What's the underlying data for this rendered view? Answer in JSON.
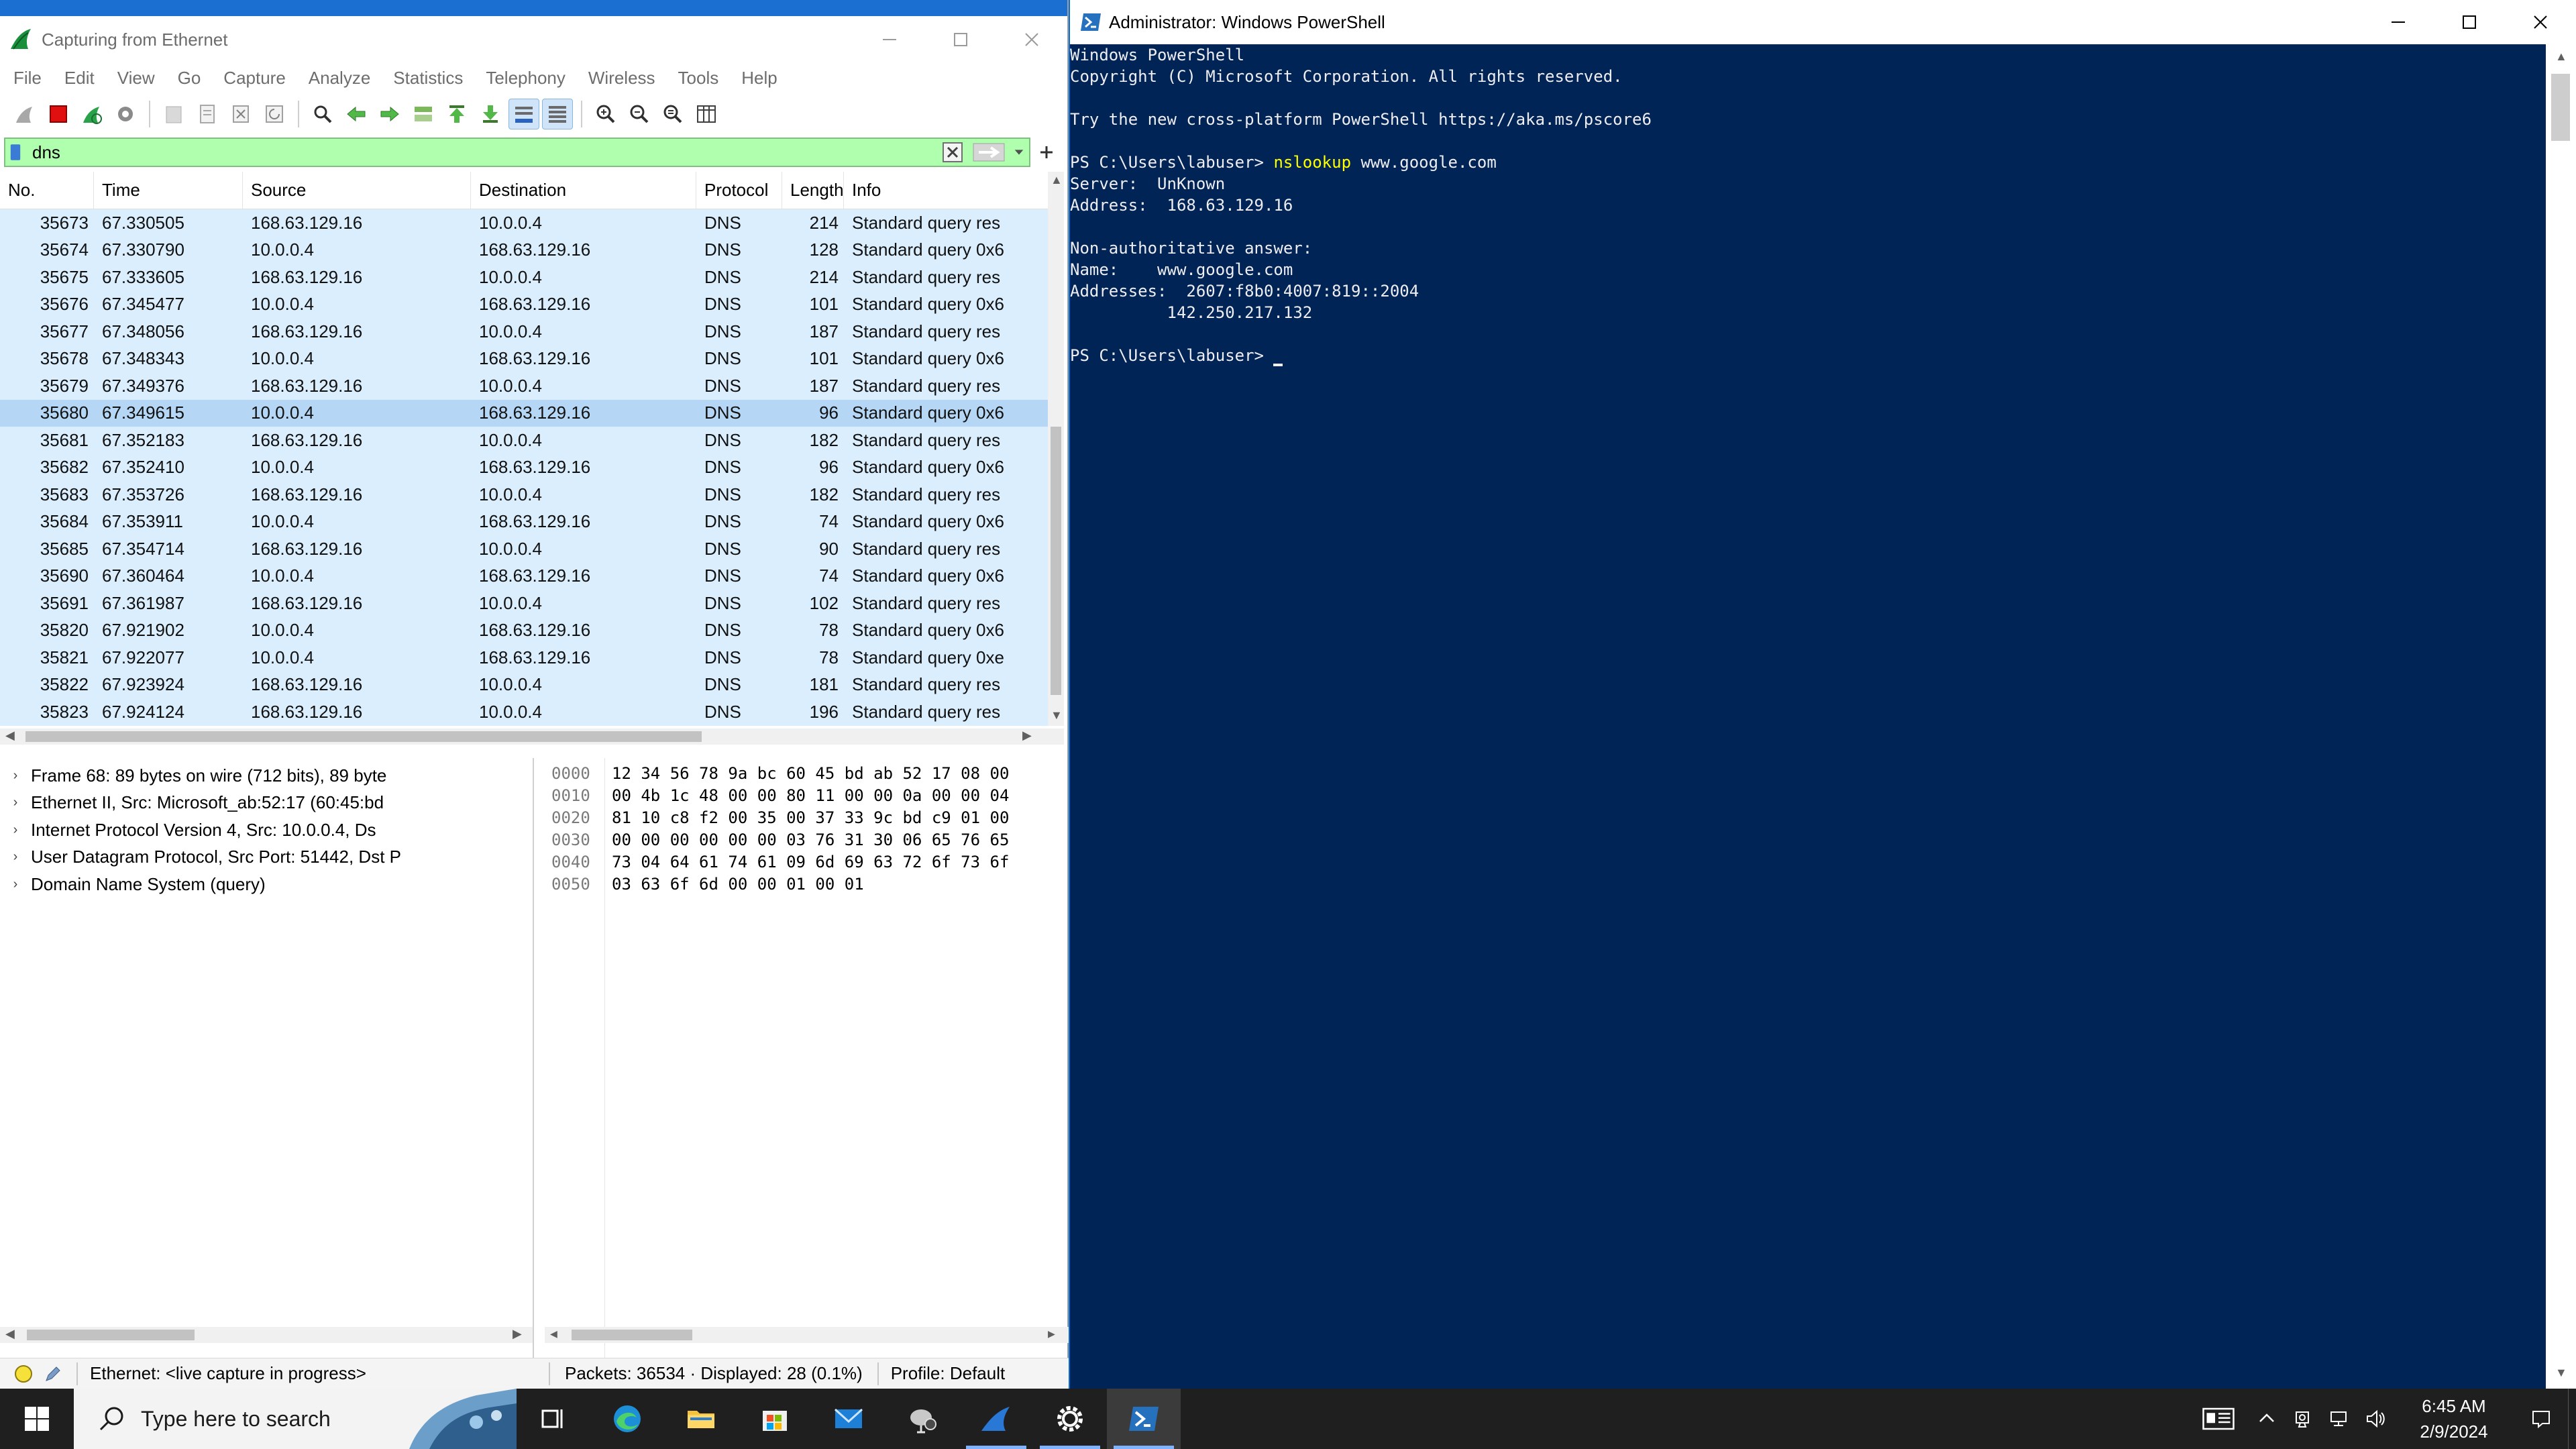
{
  "wireshark": {
    "title": "Capturing from Ethernet",
    "menu": [
      "File",
      "Edit",
      "View",
      "Go",
      "Capture",
      "Analyze",
      "Statistics",
      "Telephony",
      "Wireless",
      "Tools",
      "Help"
    ],
    "filter_value": "dns",
    "columns": [
      "No.",
      "Time",
      "Source",
      "Destination",
      "Protocol",
      "Length",
      "Info"
    ],
    "packets": [
      {
        "no": "35673",
        "time": "67.330505",
        "src": "168.63.129.16",
        "dst": "10.0.0.4",
        "proto": "DNS",
        "len": "214",
        "info": "Standard query res"
      },
      {
        "no": "35674",
        "time": "67.330790",
        "src": "10.0.0.4",
        "dst": "168.63.129.16",
        "proto": "DNS",
        "len": "128",
        "info": "Standard query 0x6"
      },
      {
        "no": "35675",
        "time": "67.333605",
        "src": "168.63.129.16",
        "dst": "10.0.0.4",
        "proto": "DNS",
        "len": "214",
        "info": "Standard query res"
      },
      {
        "no": "35676",
        "time": "67.345477",
        "src": "10.0.0.4",
        "dst": "168.63.129.16",
        "proto": "DNS",
        "len": "101",
        "info": "Standard query 0x6"
      },
      {
        "no": "35677",
        "time": "67.348056",
        "src": "168.63.129.16",
        "dst": "10.0.0.4",
        "proto": "DNS",
        "len": "187",
        "info": "Standard query res"
      },
      {
        "no": "35678",
        "time": "67.348343",
        "src": "10.0.0.4",
        "dst": "168.63.129.16",
        "proto": "DNS",
        "len": "101",
        "info": "Standard query 0x6"
      },
      {
        "no": "35679",
        "time": "67.349376",
        "src": "168.63.129.16",
        "dst": "10.0.0.4",
        "proto": "DNS",
        "len": "187",
        "info": "Standard query res"
      },
      {
        "no": "35680",
        "time": "67.349615",
        "src": "10.0.0.4",
        "dst": "168.63.129.16",
        "proto": "DNS",
        "len": "96",
        "info": "Standard query 0x6"
      },
      {
        "no": "35681",
        "time": "67.352183",
        "src": "168.63.129.16",
        "dst": "10.0.0.4",
        "proto": "DNS",
        "len": "182",
        "info": "Standard query res"
      },
      {
        "no": "35682",
        "time": "67.352410",
        "src": "10.0.0.4",
        "dst": "168.63.129.16",
        "proto": "DNS",
        "len": "96",
        "info": "Standard query 0x6"
      },
      {
        "no": "35683",
        "time": "67.353726",
        "src": "168.63.129.16",
        "dst": "10.0.0.4",
        "proto": "DNS",
        "len": "182",
        "info": "Standard query res"
      },
      {
        "no": "35684",
        "time": "67.353911",
        "src": "10.0.0.4",
        "dst": "168.63.129.16",
        "proto": "DNS",
        "len": "74",
        "info": "Standard query 0x6"
      },
      {
        "no": "35685",
        "time": "67.354714",
        "src": "168.63.129.16",
        "dst": "10.0.0.4",
        "proto": "DNS",
        "len": "90",
        "info": "Standard query res"
      },
      {
        "no": "35690",
        "time": "67.360464",
        "src": "10.0.0.4",
        "dst": "168.63.129.16",
        "proto": "DNS",
        "len": "74",
        "info": "Standard query 0x6"
      },
      {
        "no": "35691",
        "time": "67.361987",
        "src": "168.63.129.16",
        "dst": "10.0.0.4",
        "proto": "DNS",
        "len": "102",
        "info": "Standard query res"
      },
      {
        "no": "35820",
        "time": "67.921902",
        "src": "10.0.0.4",
        "dst": "168.63.129.16",
        "proto": "DNS",
        "len": "78",
        "info": "Standard query 0x6"
      },
      {
        "no": "35821",
        "time": "67.922077",
        "src": "10.0.0.4",
        "dst": "168.63.129.16",
        "proto": "DNS",
        "len": "78",
        "info": "Standard query 0xe"
      },
      {
        "no": "35822",
        "time": "67.923924",
        "src": "168.63.129.16",
        "dst": "10.0.0.4",
        "proto": "DNS",
        "len": "181",
        "info": "Standard query res"
      },
      {
        "no": "35823",
        "time": "67.924124",
        "src": "168.63.129.16",
        "dst": "10.0.0.4",
        "proto": "DNS",
        "len": "196",
        "info": "Standard query res"
      }
    ],
    "details": [
      "Frame 68: 89 bytes on wire (712 bits), 89 byte",
      "Ethernet II, Src: Microsoft_ab:52:17 (60:45:bd",
      "Internet Protocol Version 4, Src: 10.0.0.4, Ds",
      "User Datagram Protocol, Src Port: 51442, Dst P",
      "Domain Name System (query)"
    ],
    "bytes": [
      {
        "off": "0000",
        "hex": "12 34 56 78 9a bc 60 45  bd ab 52 17 08 00"
      },
      {
        "off": "0010",
        "hex": "00 4b 1c 48 00 00 80 11  00 00 0a 00 00 04"
      },
      {
        "off": "0020",
        "hex": "81 10 c8 f2 00 35 00 37  33 9c bd c9 01 00"
      },
      {
        "off": "0030",
        "hex": "00 00 00 00 00 00 03 76  31 30 06 65 76 65"
      },
      {
        "off": "0040",
        "hex": "73 04 64 61 74 61 09 6d  69 63 72 6f 73 6f"
      },
      {
        "off": "0050",
        "hex": "03 63 6f 6d 00 00 01 00  01"
      }
    ],
    "status": {
      "interface": "Ethernet: <live capture in progress>",
      "packets": "Packets: 36534 · Displayed: 28 (0.1%)",
      "profile": "Profile: Default"
    }
  },
  "powershell": {
    "title": "Administrator: Windows PowerShell",
    "lines": [
      "Windows PowerShell",
      "Copyright (C) Microsoft Corporation. All rights reserved.",
      "",
      "Try the new cross-platform PowerShell https://aka.ms/pscore6",
      "",
      "__CMD__",
      "Server:  UnKnown",
      "Address:  168.63.129.16",
      "",
      "Non-authoritative answer:",
      "Name:    www.google.com",
      "Addresses:  2607:f8b0:4007:819::2004",
      "          142.250.217.132",
      "",
      "__PROMPT__"
    ],
    "prompt": "PS C:\\Users\\labuser> ",
    "command": "nslookup",
    "command_arg": " www.google.com"
  },
  "taskbar": {
    "search_placeholder": "Type here to search",
    "time": "6:45 AM",
    "date": "2/9/2024"
  }
}
